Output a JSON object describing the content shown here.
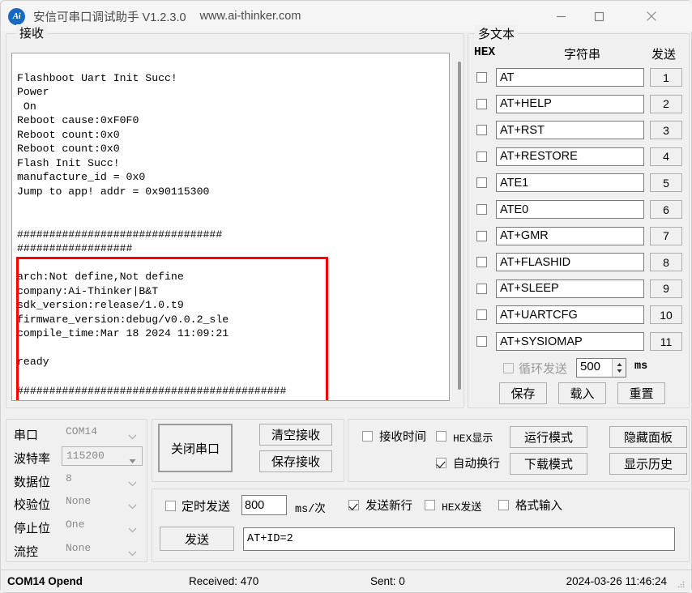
{
  "titlebar": {
    "icon": "ai-thinker-logo-icon",
    "title": "安信可串口调试助手 V1.2.3.0",
    "url": "www.ai-thinker.com",
    "minimize": "minimize-icon",
    "maximize": "maximize-icon",
    "close": "close-icon"
  },
  "receive": {
    "legend": "接收",
    "text": "\nFlashboot Uart Init Succ!\nPower\n On\nReboot cause:0xF0F0\nReboot count:0x0\nReboot count:0x0\nFlash Init Succ!\nmanufacture_id = 0x0\nJump to app! addr = 0x90115300\n\n\n################################\n##################\n\narch:Not define,Not define\ncompany:Ai-Thinker|B&T\nsdk_version:release/1.0.t9\nfirmware_version:debug/v0.0.2_sle\ncompile_time:Mar 18 2024 11:09:21\n\nready\n\n##########################################\n#######",
    "highlight_color": "#ff0000"
  },
  "multitext": {
    "legend": "多文本",
    "header": {
      "hex": "HEX",
      "string": "字符串",
      "send": "发送"
    },
    "rows": [
      {
        "hex_checked": false,
        "command": "AT",
        "send_label": "1"
      },
      {
        "hex_checked": false,
        "command": "AT+HELP",
        "send_label": "2"
      },
      {
        "hex_checked": false,
        "command": "AT+RST",
        "send_label": "3"
      },
      {
        "hex_checked": false,
        "command": "AT+RESTORE",
        "send_label": "4"
      },
      {
        "hex_checked": false,
        "command": "ATE1",
        "send_label": "5"
      },
      {
        "hex_checked": false,
        "command": "ATE0",
        "send_label": "6"
      },
      {
        "hex_checked": false,
        "command": "AT+GMR",
        "send_label": "7"
      },
      {
        "hex_checked": false,
        "command": "AT+FLASHID",
        "send_label": "8"
      },
      {
        "hex_checked": false,
        "command": "AT+SLEEP",
        "send_label": "9"
      },
      {
        "hex_checked": false,
        "command": "AT+UARTCFG",
        "send_label": "10"
      },
      {
        "hex_checked": false,
        "command": "AT+SYSIOMAP",
        "send_label": "11"
      }
    ],
    "loop": {
      "label": "循环发送",
      "checked": false,
      "interval": "500",
      "unit": "ms"
    },
    "actions": {
      "save": "保存",
      "load": "载入",
      "reset": "重置"
    }
  },
  "serial_settings": {
    "rows": [
      {
        "label": "串口",
        "value": "COM14",
        "bordered": false
      },
      {
        "label": "波特率",
        "value": "115200",
        "bordered": true
      },
      {
        "label": "数据位",
        "value": "8",
        "bordered": false
      },
      {
        "label": "校验位",
        "value": "None",
        "bordered": false
      },
      {
        "label": "停止位",
        "value": "One",
        "bordered": false
      },
      {
        "label": "流控",
        "value": "None",
        "bordered": false
      }
    ]
  },
  "controls": {
    "close_port": "关闭串口",
    "clear_receive": "清空接收",
    "save_receive": "保存接收"
  },
  "options": {
    "recv_time": {
      "label": "接收时间",
      "checked": false
    },
    "hex_display": {
      "label": "HEX显示",
      "checked": false
    },
    "auto_wrap": {
      "label": "自动换行",
      "checked": true
    },
    "run_mode": "运行模式",
    "download_mode": "下载模式",
    "hide_panel": "隐藏面板",
    "show_history": "显示历史"
  },
  "send": {
    "timed": {
      "label": "定时发送",
      "checked": false
    },
    "interval": "800",
    "unit": "ms/次",
    "send_newline": {
      "label": "发送新行",
      "checked": true
    },
    "hex_send": {
      "label": "HEX发送",
      "checked": false
    },
    "format_input": {
      "label": "格式输入",
      "checked": false
    },
    "send_button": "发送",
    "input_value": "AT+ID=2"
  },
  "statusbar": {
    "port_status": "COM14 Opend",
    "received": "Received: 470",
    "sent": "Sent: 0",
    "datetime": "2024-03-26 11:46:24"
  }
}
